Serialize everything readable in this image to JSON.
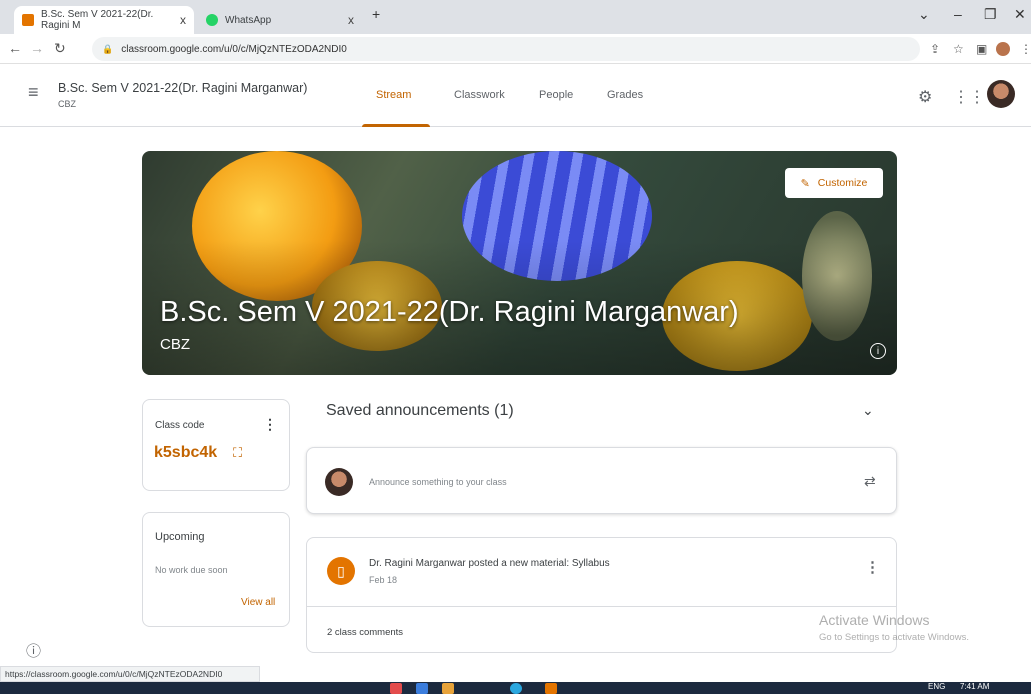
{
  "browser": {
    "tabs": [
      {
        "title": "B.Sc. Sem V 2021-22(Dr. Ragini M",
        "close": "x"
      },
      {
        "title": "WhatsApp",
        "close": "x"
      }
    ],
    "new_tab": "+",
    "url": "classroom.google.com/u/0/c/MjQzNTEzODA2NDI0",
    "status_url": "https://classroom.google.com/u/0/c/MjQzNTEzODA2NDI0"
  },
  "header": {
    "class_title": "B.Sc. Sem V 2021-22(Dr. Ragini Marganwar)",
    "class_section": "CBZ",
    "tabs": [
      {
        "label": "Stream",
        "active": true
      },
      {
        "label": "Classwork",
        "active": false
      },
      {
        "label": "People",
        "active": false
      },
      {
        "label": "Grades",
        "active": false
      }
    ]
  },
  "banner": {
    "title": "B.Sc. Sem V 2021-22(Dr. Ragini Marganwar)",
    "section": "CBZ",
    "customize_label": "Customize"
  },
  "class_code": {
    "label": "Class code",
    "value": "k5sbc4k"
  },
  "upcoming": {
    "title": "Upcoming",
    "text": "No work due soon",
    "link": "View all"
  },
  "stream": {
    "saved_announcements": "Saved announcements (1)",
    "announce_placeholder": "Announce something to your class",
    "post": {
      "title": "Dr. Ragini Marganwar posted a new material: Syllabus",
      "date": "Feb 18",
      "comments": "2 class comments"
    }
  },
  "watermark": {
    "line1": "Activate Windows",
    "line2": "Go to Settings to activate Windows."
  },
  "taskbar": {
    "lang": "ENG",
    "time": "7:41 AM"
  },
  "colors": {
    "accent": "#c26401",
    "post_icon": "#e37400"
  }
}
